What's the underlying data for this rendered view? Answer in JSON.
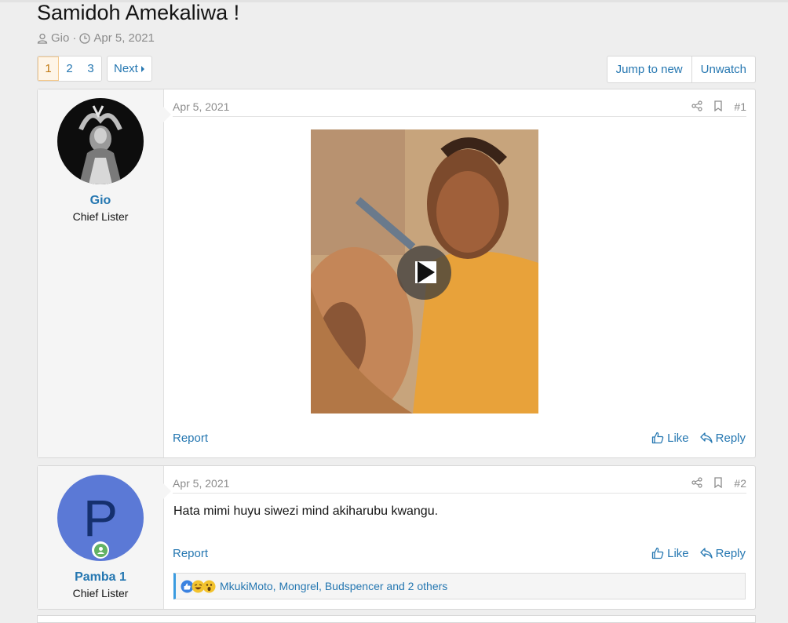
{
  "thread": {
    "title": "Samidoh Amekaliwa !",
    "author": "Gio",
    "date": "Apr 5, 2021"
  },
  "pagination": {
    "pages": [
      "1",
      "2",
      "3"
    ],
    "current": "1",
    "next_label": "Next"
  },
  "actions": {
    "jump_label": "Jump to new",
    "unwatch_label": "Unwatch"
  },
  "posts": [
    {
      "username": "Gio",
      "user_title": "Chief Lister",
      "date": "Apr 5, 2021",
      "number": "#1",
      "content_type": "video",
      "report_label": "Report",
      "like_label": "Like",
      "reply_label": "Reply"
    },
    {
      "username": "Pamba 1",
      "avatar_letter": "P",
      "avatar_color": "#5b79d6",
      "online": true,
      "user_title": "Chief Lister",
      "date": "Apr 5, 2021",
      "number": "#2",
      "message": "Hata mimi huyu siwezi mind akiharubu kwangu.",
      "report_label": "Report",
      "like_label": "Like",
      "reply_label": "Reply",
      "reactions_text": "MkukiMoto, Mongrel, Budspencer and 2 others",
      "reaction_icons": [
        "like-icon",
        "laugh-icon",
        "wow-icon"
      ]
    }
  ],
  "colors": {
    "link": "#2577b1",
    "current_page": "#c27a14",
    "background": "#eeeeee"
  }
}
